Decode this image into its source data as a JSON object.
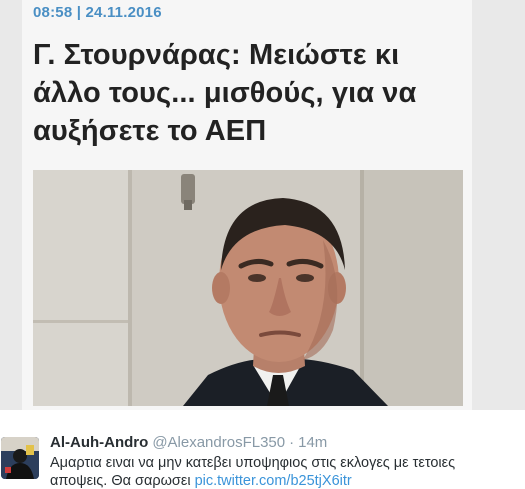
{
  "article": {
    "meta": "08:58 | 24.11.2016",
    "headline": "Γ. Στουρνάρας: Μειώστε κι άλλο τους... μισθούς, για να αυξήσετε το ΑΕΠ"
  },
  "tweet": {
    "display_name": "Al-Auh-Andro",
    "handle": "@AlexandrosFL350",
    "separator": "·",
    "time": "14m",
    "text": "Αμαρτια ειναι να μην κατεβει υποψηφιος στις εκλογες με τετοιες αποψεις. Θα σαρωσει",
    "link": "pic.twitter.com/b25tjX6itr"
  },
  "colors": {
    "meta_blue": "#4a8fc4",
    "headline": "#222222",
    "name": "#292f33",
    "muted": "#8899a6",
    "link": "#3b94d9"
  }
}
